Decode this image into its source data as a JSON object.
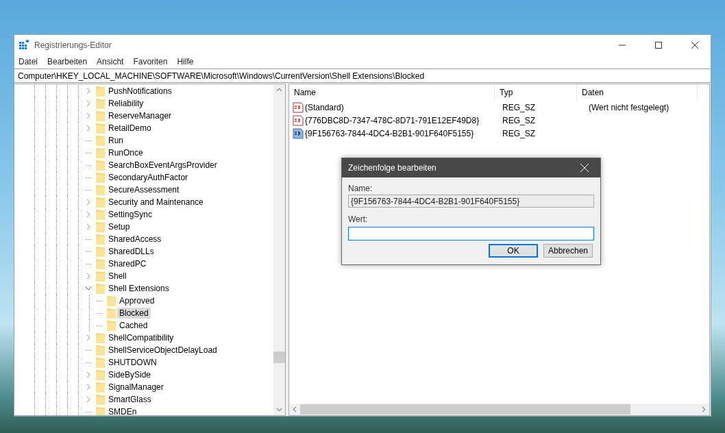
{
  "window": {
    "title": "Registrierungs-Editor"
  },
  "menu": [
    "Datei",
    "Bearbeiten",
    "Ansicht",
    "Favoriten",
    "Hilfe"
  ],
  "address": "Computer\\HKEY_LOCAL_MACHINE\\SOFTWARE\\Microsoft\\Windows\\CurrentVersion\\Shell Extensions\\Blocked",
  "tree": [
    {
      "label": "PushNotifications",
      "kind": "collapsed",
      "selected": false
    },
    {
      "label": "Reliability",
      "kind": "collapsed",
      "selected": false
    },
    {
      "label": "ReserveManager",
      "kind": "collapsed",
      "selected": false
    },
    {
      "label": "RetailDemo",
      "kind": "collapsed",
      "selected": false
    },
    {
      "label": "Run",
      "kind": "leaf",
      "selected": false
    },
    {
      "label": "RunOnce",
      "kind": "leaf",
      "selected": false
    },
    {
      "label": "SearchBoxEventArgsProvider",
      "kind": "leaf",
      "selected": false
    },
    {
      "label": "SecondaryAuthFactor",
      "kind": "leaf",
      "selected": false
    },
    {
      "label": "SecureAssessment",
      "kind": "leaf",
      "selected": false
    },
    {
      "label": "Security and Maintenance",
      "kind": "collapsed",
      "selected": false
    },
    {
      "label": "SettingSync",
      "kind": "collapsed",
      "selected": false
    },
    {
      "label": "Setup",
      "kind": "collapsed",
      "selected": false
    },
    {
      "label": "SharedAccess",
      "kind": "leaf",
      "selected": false
    },
    {
      "label": "SharedDLLs",
      "kind": "leaf",
      "selected": false
    },
    {
      "label": "SharedPC",
      "kind": "leaf",
      "selected": false
    },
    {
      "label": "Shell",
      "kind": "collapsed",
      "selected": false
    },
    {
      "label": "Shell Extensions",
      "kind": "expanded",
      "selected": false,
      "children": [
        {
          "label": "Approved",
          "kind": "leaf",
          "selected": false
        },
        {
          "label": "Blocked",
          "kind": "leaf",
          "selected": true
        },
        {
          "label": "Cached",
          "kind": "leaf",
          "selected": false
        }
      ]
    },
    {
      "label": "ShellCompatibility",
      "kind": "collapsed",
      "selected": false
    },
    {
      "label": "ShellServiceObjectDelayLoad",
      "kind": "leaf",
      "selected": false
    },
    {
      "label": "SHUTDOWN",
      "kind": "leaf",
      "selected": false
    },
    {
      "label": "SideBySide",
      "kind": "collapsed",
      "selected": false
    },
    {
      "label": "SignalManager",
      "kind": "collapsed",
      "selected": false
    },
    {
      "label": "SmartGlass",
      "kind": "collapsed",
      "selected": false
    },
    {
      "label": "SMDEn",
      "kind": "leaf",
      "selected": false
    }
  ],
  "list": {
    "columns": [
      "Name",
      "Typ",
      "Daten"
    ],
    "rows": [
      {
        "name": "(Standard)",
        "type": "REG_SZ",
        "data": "(Wert nicht festgelegt)",
        "selected": false
      },
      {
        "name": "{776DBC8D-7347-478C-8D71-791E12EF49D8}",
        "type": "REG_SZ",
        "selected": false
      },
      {
        "name": "{9F156763-7844-4DC4-B2B1-901F640F5155}",
        "type": "REG_SZ",
        "selected": true
      }
    ]
  },
  "dialog": {
    "title": "Zeichenfolge bearbeiten",
    "name_label": "Name:",
    "name_value": "{9F156763-7844-4DC4-B2B1-901F640F5155}",
    "value_label": "Wert:",
    "value_focused": true,
    "buttons": [
      {
        "label": "OK",
        "default": true
      },
      {
        "label": "Abbrechen",
        "default": false
      }
    ]
  }
}
